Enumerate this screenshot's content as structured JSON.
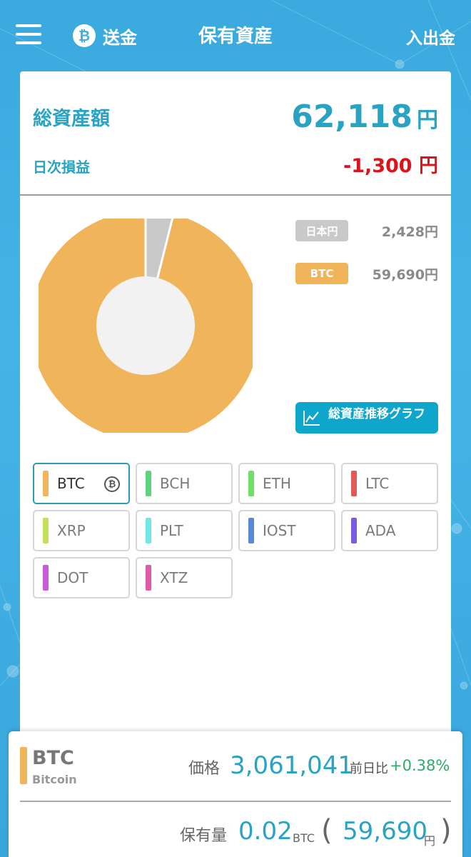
{
  "header": {
    "send_label": "送金",
    "send_icon": "bitcoin-icon",
    "title": "保有資産",
    "deposit_label": "入出金"
  },
  "summary": {
    "total_label": "総資産額",
    "total_value": "62,118",
    "total_unit": "円",
    "daily_label": "日次損益",
    "daily_value": "-1,300 円"
  },
  "allocation": {
    "items": [
      {
        "label": "日本円",
        "amount": "2,428円",
        "value": 2428,
        "color": "#c9c9c9"
      },
      {
        "label": "BTC",
        "amount": "59,690円",
        "value": 59690,
        "color": "#f0b55b"
      }
    ],
    "trend_button_label": "総資産推移グラフ"
  },
  "coins": [
    {
      "label": "BTC",
      "color": "#f0b55b",
      "selected": true,
      "mark": "₿"
    },
    {
      "label": "BCH",
      "color": "#5ed37f"
    },
    {
      "label": "ETH",
      "color": "#6ee06a"
    },
    {
      "label": "LTC",
      "color": "#e05a5a"
    },
    {
      "label": "XRP",
      "color": "#c2e05a"
    },
    {
      "label": "PLT",
      "color": "#6ee8e8"
    },
    {
      "label": "IOST",
      "color": "#5a86d8"
    },
    {
      "label": "ADA",
      "color": "#7a5ae0"
    },
    {
      "label": "DOT",
      "color": "#c95ad8"
    },
    {
      "label": "XTZ",
      "color": "#e05aa8"
    }
  ],
  "detail": {
    "symbol": "BTC",
    "name": "Bitcoin",
    "price_label": "価格",
    "price_value": "3,061,041",
    "change_label": "前日比",
    "change_value": "+0.38%",
    "holding_label": "保有量",
    "holding_qty": "0.02",
    "holding_unit": "BTC",
    "paren_open": "(",
    "holding_jpy": "59,690",
    "holding_jpy_unit": "円",
    "paren_close": ")"
  }
}
